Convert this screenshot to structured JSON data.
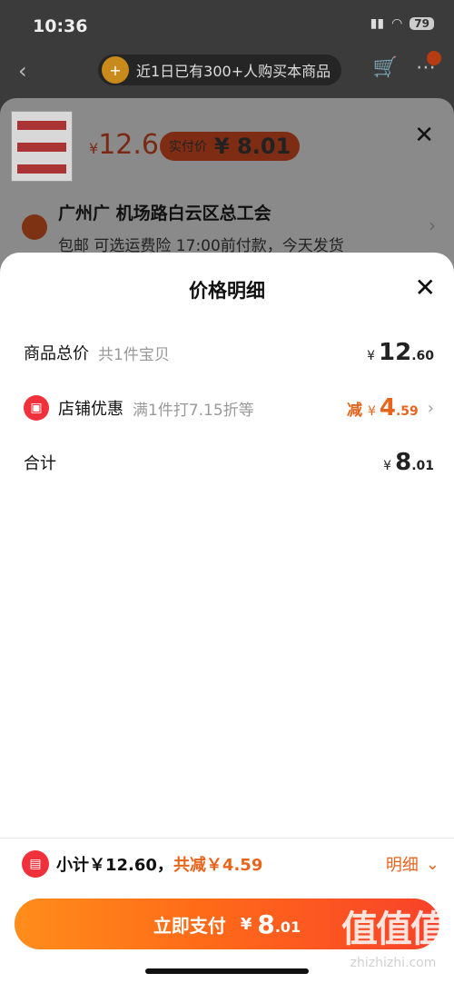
{
  "status": {
    "time": "10:36",
    "battery": "79"
  },
  "nav": {
    "toast": "近1日已有300+人购买本商品"
  },
  "product_sheet": {
    "price_yen": "¥",
    "price": "12.6",
    "actual_label": "实付价",
    "actual_value": "¥ 8.01",
    "address_title": "广州广 机场路白云区总工会",
    "address_sub": "包邮  可选运费险  17:00前付款，今天发货"
  },
  "detail_sheet": {
    "title": "价格明细",
    "rows": [
      {
        "label": "商品总价",
        "sub": "共1件宝贝",
        "yen": "¥",
        "int": "12",
        "dec": ".60"
      },
      {
        "label": "店铺优惠",
        "sub": "满1件打7.15折等",
        "prefix": "减",
        "yen": "¥",
        "int": "4",
        "dec": ".59"
      },
      {
        "label": "合计",
        "yen": "¥",
        "int": "8",
        "dec": ".01"
      }
    ]
  },
  "bottom": {
    "subtotal": "小计￥12.60，",
    "total_off": "共减￥4.59",
    "detail_link": "明细",
    "pay_label": "立即支付",
    "pay_yen": "¥",
    "pay_int": "8",
    "pay_dec": ".01"
  },
  "watermark": {
    "big": "值值值",
    "small": "zhizhizhi.com"
  },
  "colors": {
    "accent": "#e8641c",
    "danger": "#f0313b"
  }
}
